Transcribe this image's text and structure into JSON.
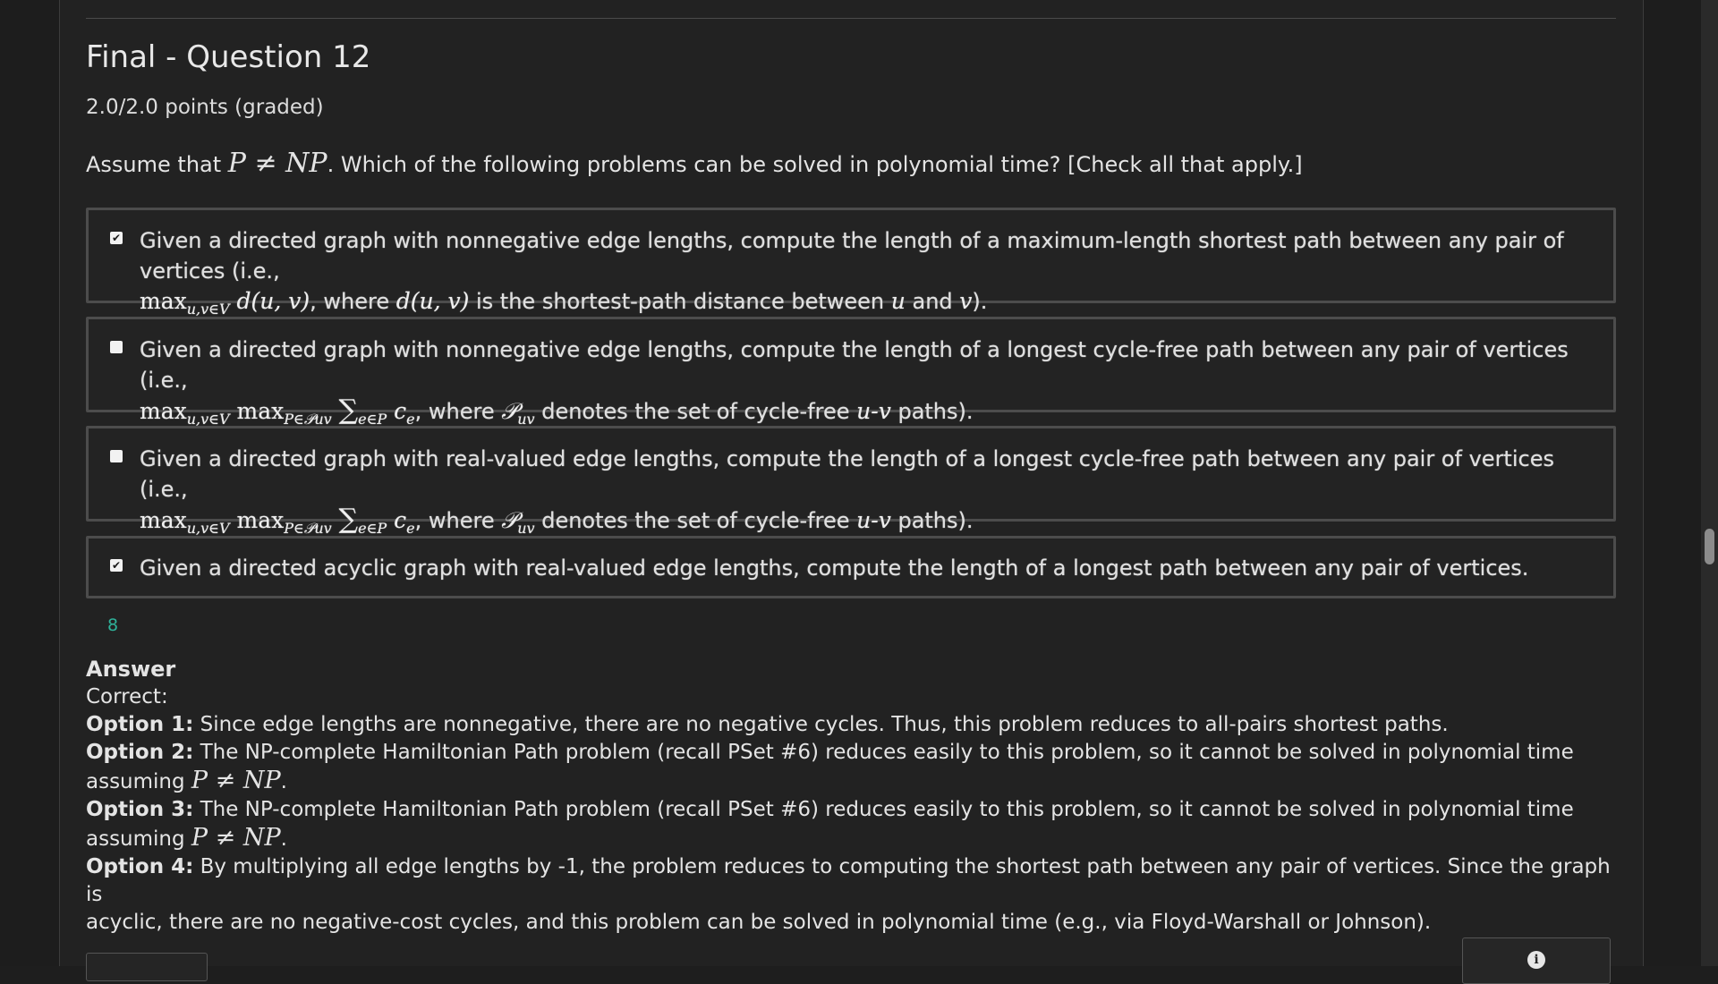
{
  "question": {
    "title": "Final - Question 12",
    "points": "2.0/2.0 points (graded)",
    "prompt_before": "Assume that ",
    "prompt_math": "P ≠ NP",
    "prompt_after": ". Which of the following problems can be solved in polynomial time? [Check all that apply.]"
  },
  "options": [
    {
      "checked": true,
      "line1": "Given a directed graph with nonnegative edge lengths, compute the length of a maximum-length shortest path between any pair of vertices (i.e.,",
      "math1": "max",
      "math1_sub": "u,v∈V",
      "math1_rest": " d(u, v)",
      "text_a": ", where ",
      "math2": "d(u, v)",
      "text_b": " is the shortest-path distance between ",
      "math3": "u",
      "text_c": " and ",
      "math4": "v",
      "text_d": ")."
    },
    {
      "checked": false,
      "line1": "Given a directed graph with nonnegative edge lengths, compute the length of a longest cycle-free path between any pair of vertices (i.e.,",
      "math_max1": "max",
      "math_sub1": "u,v∈V",
      "math_max2": "max",
      "math_sub2": "P∈𝒫uv",
      "math_sum": "∑",
      "math_sum_sub": "e∈P",
      "math_c": "c",
      "math_c_sub": "e",
      "text_a": ", where ",
      "math_p": "𝒫",
      "math_p_sub": "uv",
      "text_b": " denotes the set of cycle-free ",
      "math_uv": "u-v",
      "text_c": " paths)."
    },
    {
      "checked": false,
      "line1": "Given a directed graph with real-valued edge lengths, compute the length of a longest cycle-free path between any pair of vertices (i.e.,",
      "math_max1": "max",
      "math_sub1": "u,v∈V",
      "math_max2": "max",
      "math_sub2": "P∈𝒫uv",
      "math_sum": "∑",
      "math_sum_sub": "e∈P",
      "math_c": "c",
      "math_c_sub": "e",
      "text_a": ", where ",
      "math_p": "𝒫",
      "math_p_sub": "uv",
      "text_b": " denotes the set of cycle-free ",
      "math_uv": "u-v",
      "text_c": " paths)."
    },
    {
      "checked": true,
      "line1": "Given a directed acyclic graph with real-valued edge lengths, compute the length of a longest path between any pair of vertices."
    }
  ],
  "checkmark": "✔",
  "counter": "8",
  "answer": {
    "heading": "Answer",
    "status": "Correct:",
    "items": [
      {
        "label": "Option 1:",
        "text": " Since edge lengths are nonnegative, there are no negative cycles. Thus, this problem reduces to all-pairs shortest paths.",
        "tail": "",
        "math": "",
        "end": ""
      },
      {
        "label": "Option 2:",
        "text": " The NP-complete Hamiltonian Path problem (recall PSet #6) reduces easily to this problem, so it cannot be solved in polynomial time",
        "tail": "assuming ",
        "math": "P ≠ NP",
        "end": "."
      },
      {
        "label": "Option 3:",
        "text": " The NP-complete Hamiltonian Path problem (recall PSet #6) reduces easily to this problem, so it cannot be solved in polynomial time",
        "tail": "assuming ",
        "math": "P ≠ NP",
        "end": "."
      },
      {
        "label": "Option 4:",
        "text": " By multiplying all edge lengths by -1, the problem reduces to computing the shortest path between any pair of vertices. Since the graph is",
        "tail": "acyclic, there are no negative-cost cycles, and this problem can be solved in polynomial time (e.g., via Floyd-Warshall or Johnson).",
        "math": "",
        "end": ""
      }
    ]
  },
  "info_icon": "i"
}
